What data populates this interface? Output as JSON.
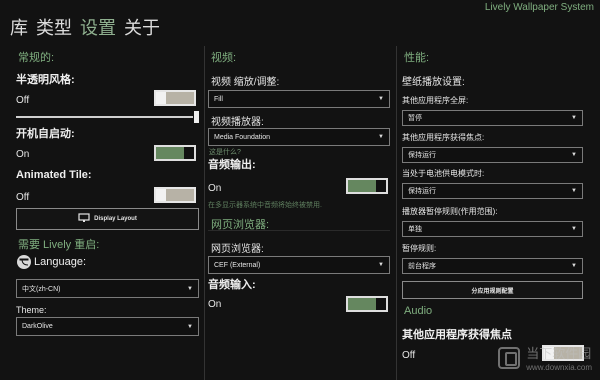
{
  "header": {
    "app_title": "Lively Wallpaper System",
    "tabs": [
      "库",
      "类型",
      "设置",
      "关于"
    ],
    "active_tab_index": 2
  },
  "left": {
    "section_general": "常规的:",
    "transparent_label": "半透明风格:",
    "transparent_value": "Off",
    "startup_label": "开机自启动:",
    "startup_value": "On",
    "animated_tile_label": "Animated Tile:",
    "animated_tile_value": "Off",
    "display_layout_button": "Display Layout",
    "restart_section": "需要 Lively 重启:",
    "language_label": "Language:",
    "language_value": "中文(zh-CN)",
    "theme_label": "Theme:",
    "theme_value": "DarkOlive"
  },
  "middle": {
    "section_video": "视频:",
    "scaling_label": "视频 缩放/调整:",
    "scaling_value": "Fill",
    "player_label": "视频播放器:",
    "player_value": "Media Foundation",
    "help_link": "这是什么?",
    "audio_output_label": "音频输出:",
    "audio_output_value": "On",
    "audio_hint": "在多显示器系统中音频将始终被禁用.",
    "section_web": "网页浏览器:",
    "web_browser_label": "网页浏览器:",
    "web_browser_value": "CEF (External)",
    "audio_input_label": "音频输入:",
    "audio_input_value": "On"
  },
  "right": {
    "section_performance": "性能:",
    "wallpaper_playback_label": "壁纸播放设置:",
    "fullscreen_label": "其他应用程序全屏:",
    "fullscreen_value": "暂停",
    "focus_label": "其他应用程序获得焦点:",
    "focus_value": "保持运行",
    "battery_label": "当处于电池供电模式时:",
    "battery_value": "保持运行",
    "pause_rule_scope_label": "播放器暂停规则(作用范围):",
    "pause_rule_scope_value": "单独",
    "pause_rule_label": "暂停规则:",
    "pause_rule_value": "前台程序",
    "app_rules_button": "分应用规则配置",
    "section_audio": "Audio",
    "audio_focus_label": "其他应用程序获得焦点",
    "audio_focus_value": "Off"
  },
  "watermark": {
    "name": "当下软件园",
    "url": "www.downxia.com"
  }
}
